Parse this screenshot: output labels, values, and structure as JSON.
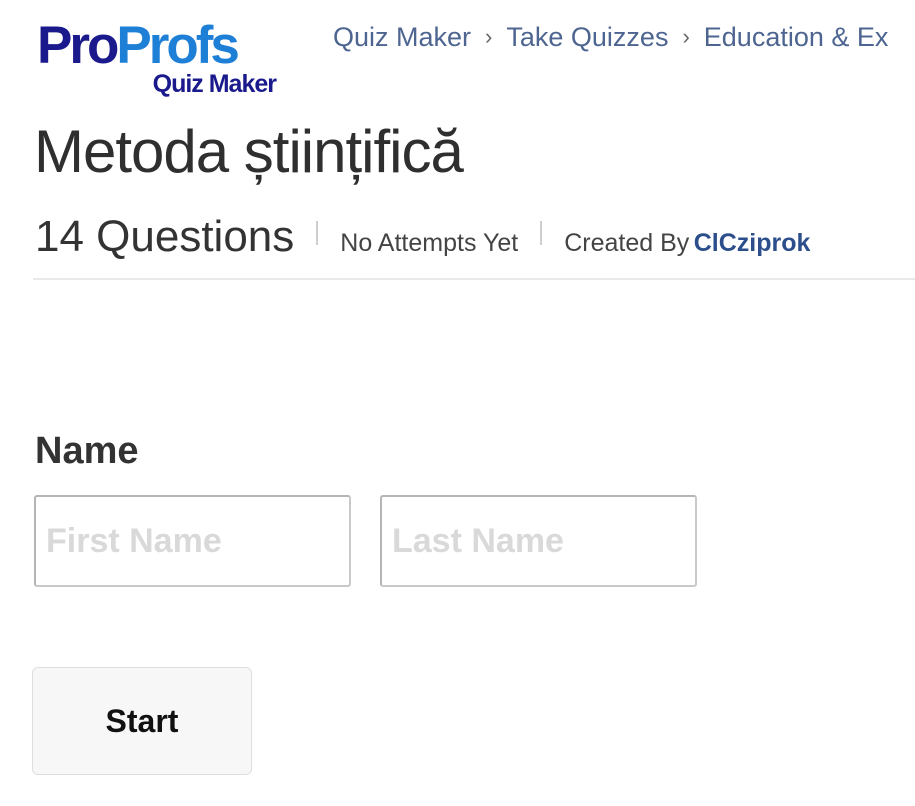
{
  "logo": {
    "part1": "Pro",
    "part2": "Profs",
    "subtitle": "Quiz Maker"
  },
  "breadcrumb": {
    "items": [
      "Quiz Maker",
      "Take Quizzes",
      "Education & Ex"
    ],
    "separator": "›"
  },
  "quiz": {
    "title": "Metoda științifică",
    "question_count": "14 Questions",
    "attempts": "No Attempts Yet",
    "created_by_label": "Created By",
    "author": "ClCziprok"
  },
  "form": {
    "name_label": "Name",
    "first_name_placeholder": "First Name",
    "last_name_placeholder": "Last Name",
    "first_name_value": "",
    "last_name_value": "",
    "start_label": "Start"
  },
  "colors": {
    "brand_dark": "#1a1a8c",
    "brand_light": "#1e7fd6",
    "link": "#4d6590",
    "author": "#2c4f8c"
  }
}
